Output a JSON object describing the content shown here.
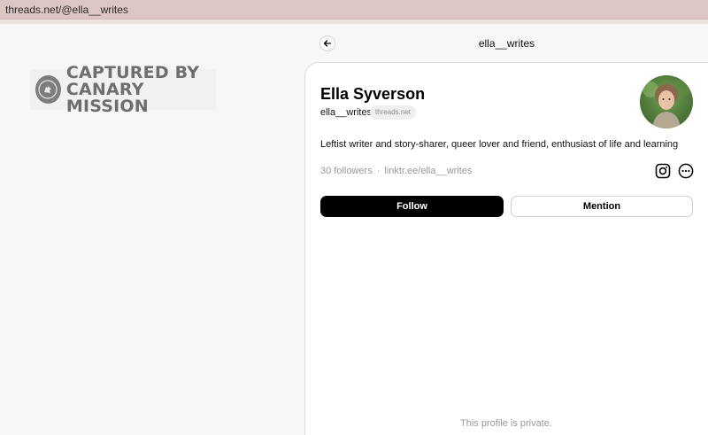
{
  "browser": {
    "url": "threads.net/@ella__writes"
  },
  "watermark": {
    "line1": "CAPTURED BY",
    "line2": "CANARY MISSION"
  },
  "header": {
    "username": "ella__writes"
  },
  "profile": {
    "name": "Ella Syverson",
    "handle": "ella__writes",
    "domain_badge": "threads.net",
    "bio": "Leftist writer and story-sharer, queer lover and friend, enthusiast of life and learning",
    "followers": "30 followers",
    "separator": "·",
    "link": "linktr.ee/ella__writes"
  },
  "actions": {
    "follow_label": "Follow",
    "mention_label": "Mention"
  },
  "status": {
    "private_message": "This profile is private."
  },
  "icons": {
    "back": "arrow-left-icon",
    "instagram": "instagram-icon",
    "more": "more-circle-icon"
  },
  "colors": {
    "address_bar": "#dcc6c3",
    "follow_bg": "#000000",
    "muted_text": "#999999"
  }
}
